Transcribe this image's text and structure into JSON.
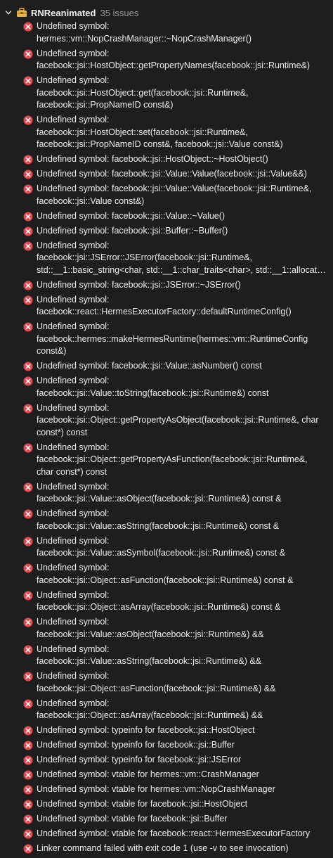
{
  "group": {
    "title": "RNReanimated",
    "count": "35 issues",
    "icons": {
      "expand": "chevron-down-icon",
      "target": "toolbox-icon"
    }
  },
  "colors": {
    "background": "#1e1e1e",
    "error": "#e5484d",
    "toolbox": "#e9b23d"
  },
  "issues": [
    "Undefined symbol:\nhermes::vm::NopCrashManager::~NopCrashManager()",
    "Undefined symbol:\nfacebook::jsi::HostObject::getPropertyNames(facebook::jsi::Runtime&)",
    "Undefined symbol:\nfacebook::jsi::HostObject::get(facebook::jsi::Runtime&,\nfacebook::jsi::PropNameID const&)",
    "Undefined symbol:\nfacebook::jsi::HostObject::set(facebook::jsi::Runtime&,\nfacebook::jsi::PropNameID const&, facebook::jsi::Value const&)",
    "Undefined symbol: facebook::jsi::HostObject::~HostObject()",
    "Undefined symbol: facebook::jsi::Value::Value(facebook::jsi::Value&&)",
    "Undefined symbol: facebook::jsi::Value::Value(facebook::jsi::Runtime&,\nfacebook::jsi::Value const&)",
    "Undefined symbol: facebook::jsi::Value::~Value()",
    "Undefined symbol: facebook::jsi::Buffer::~Buffer()",
    "Undefined symbol:\nfacebook::jsi::JSError::JSError(facebook::jsi::Runtime&,\nstd::__1::basic_string<char, std::__1::char_traits<char>, std::__1::allocat…",
    "Undefined symbol: facebook::jsi::JSError::~JSError()",
    "Undefined symbol:\nfacebook::react::HermesExecutorFactory::defaultRuntimeConfig()",
    "Undefined symbol:\nfacebook::hermes::makeHermesRuntime(hermes::vm::RuntimeConfig\nconst&)",
    "Undefined symbol: facebook::jsi::Value::asNumber() const",
    "Undefined symbol:\nfacebook::jsi::Value::toString(facebook::jsi::Runtime&) const",
    "Undefined symbol:\nfacebook::jsi::Object::getPropertyAsObject(facebook::jsi::Runtime&, char\nconst*) const",
    "Undefined symbol:\nfacebook::jsi::Object::getPropertyAsFunction(facebook::jsi::Runtime&,\nchar const*) const",
    "Undefined symbol:\nfacebook::jsi::Value::asObject(facebook::jsi::Runtime&) const &",
    "Undefined symbol:\nfacebook::jsi::Value::asString(facebook::jsi::Runtime&) const &",
    "Undefined symbol:\nfacebook::jsi::Value::asSymbol(facebook::jsi::Runtime&) const &",
    "Undefined symbol:\nfacebook::jsi::Object::asFunction(facebook::jsi::Runtime&) const &",
    "Undefined symbol:\nfacebook::jsi::Object::asArray(facebook::jsi::Runtime&) const &",
    "Undefined symbol:\nfacebook::jsi::Value::asObject(facebook::jsi::Runtime&) &&",
    "Undefined symbol:\nfacebook::jsi::Value::asString(facebook::jsi::Runtime&) &&",
    "Undefined symbol:\nfacebook::jsi::Object::asFunction(facebook::jsi::Runtime&) &&",
    "Undefined symbol:\nfacebook::jsi::Object::asArray(facebook::jsi::Runtime&) &&",
    "Undefined symbol: typeinfo for facebook::jsi::HostObject",
    "Undefined symbol: typeinfo for facebook::jsi::Buffer",
    "Undefined symbol: typeinfo for facebook::jsi::JSError",
    "Undefined symbol: vtable for hermes::vm::CrashManager",
    "Undefined symbol: vtable for hermes::vm::NopCrashManager",
    "Undefined symbol: vtable for facebook::jsi::HostObject",
    "Undefined symbol: vtable for facebook::jsi::Buffer",
    "Undefined symbol: vtable for facebook::react::HermesExecutorFactory",
    "Linker command failed with exit code 1 (use -v to see invocation)"
  ]
}
